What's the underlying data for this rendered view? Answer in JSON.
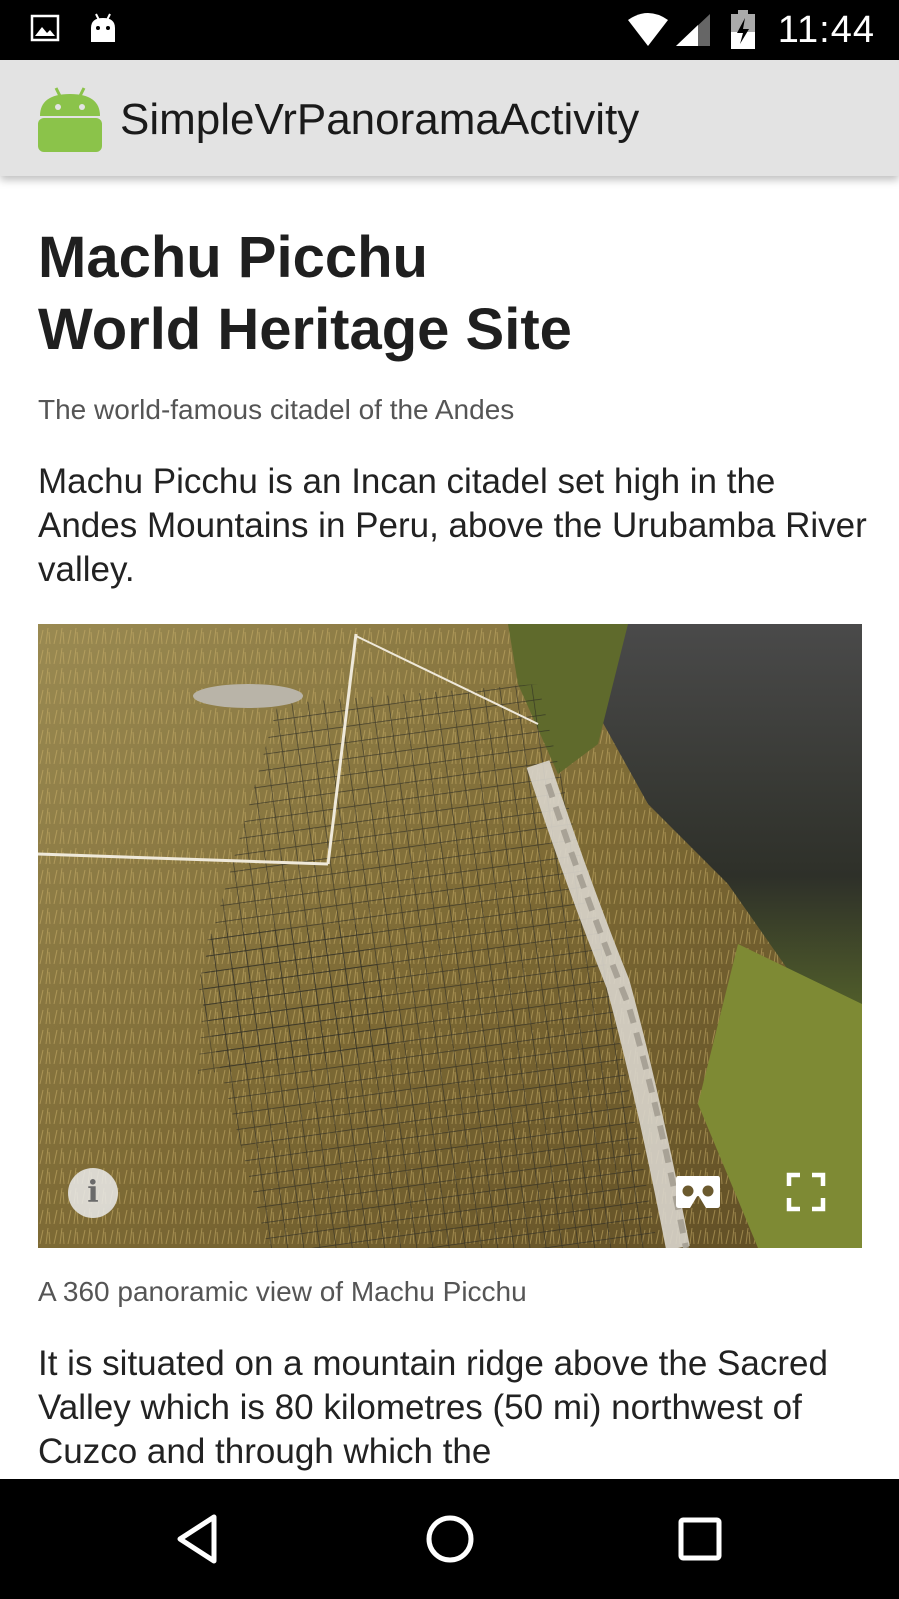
{
  "status_bar": {
    "time": "11:44",
    "left_icons": [
      "image-notification-icon",
      "android-notification-icon"
    ],
    "right_icons": [
      "wifi-icon",
      "cell-signal-icon",
      "battery-charging-icon"
    ]
  },
  "app_bar": {
    "title": "SimpleVrPanoramaActivity",
    "icon": "android-app-icon"
  },
  "article": {
    "title_line1": "Machu Picchu",
    "title_line2": "World Heritage Site",
    "subtitle": "The world-famous citadel of the Andes",
    "intro": "Machu Picchu is an Incan citadel set high in the Andes Mountains in Peru, above the Urubamba River valley.",
    "panorama": {
      "controls": [
        "info-icon",
        "cardboard-vr-icon",
        "fullscreen-icon"
      ],
      "info_label": "i"
    },
    "caption": "A 360 panoramic view of Machu Picchu",
    "body": "It is situated on a mountain ridge above the Sacred Valley which is 80 kilometres (50 mi) northwest of Cuzco and through which the"
  },
  "nav_bar": {
    "buttons": [
      "back-icon",
      "home-icon",
      "recents-icon"
    ]
  },
  "colors": {
    "status_bar": "#000000",
    "app_bar": "#e3e3e3",
    "android_green": "#8bc34a",
    "title_text": "#1f1f1f",
    "secondary_text": "#555555"
  }
}
